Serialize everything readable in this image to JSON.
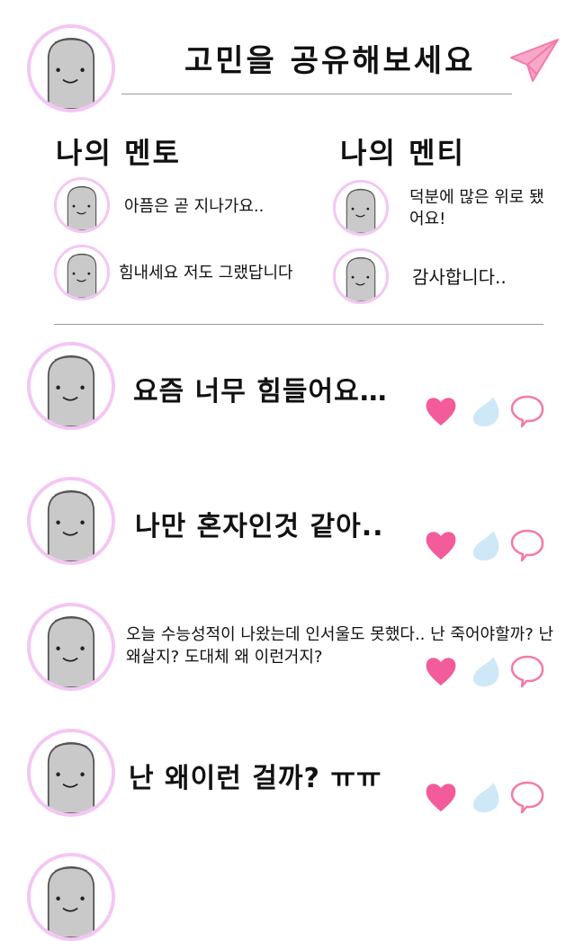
{
  "header": {
    "title": "고민을 공유해보세요"
  },
  "mentors": {
    "heading": "나의 멘토",
    "items": [
      {
        "message": "아픔은 곧 지나가요.."
      },
      {
        "message": "힘내세요 저도 그랬답니다"
      }
    ]
  },
  "mentees": {
    "heading": "나의 멘티",
    "items": [
      {
        "message": "덕분에 많은 위로 됐어요!"
      },
      {
        "message": "감사합니다.."
      }
    ]
  },
  "posts": [
    {
      "text": "요즘 너무 힘들어요…"
    },
    {
      "text": "나만 혼자인것 같아.."
    },
    {
      "text": "오늘 수능성적이 나왔는데 인서울도 못했다.. 난 죽어야할까? 난 왜살지? 도대체 왜 이런거지?"
    },
    {
      "text": "난 왜이런 걸까? ㅠㅠ"
    }
  ],
  "colors": {
    "avatar_ring": "#f4c6f4",
    "heart": "#f45b9a",
    "drop": "#cfe8f7",
    "bubble": "#f47aa8",
    "plane": "#f47aa8"
  },
  "icons": {
    "share": "paper-plane-icon",
    "like": "heart-icon",
    "sad": "tear-drop-icon",
    "comment": "speech-bubble-icon"
  }
}
